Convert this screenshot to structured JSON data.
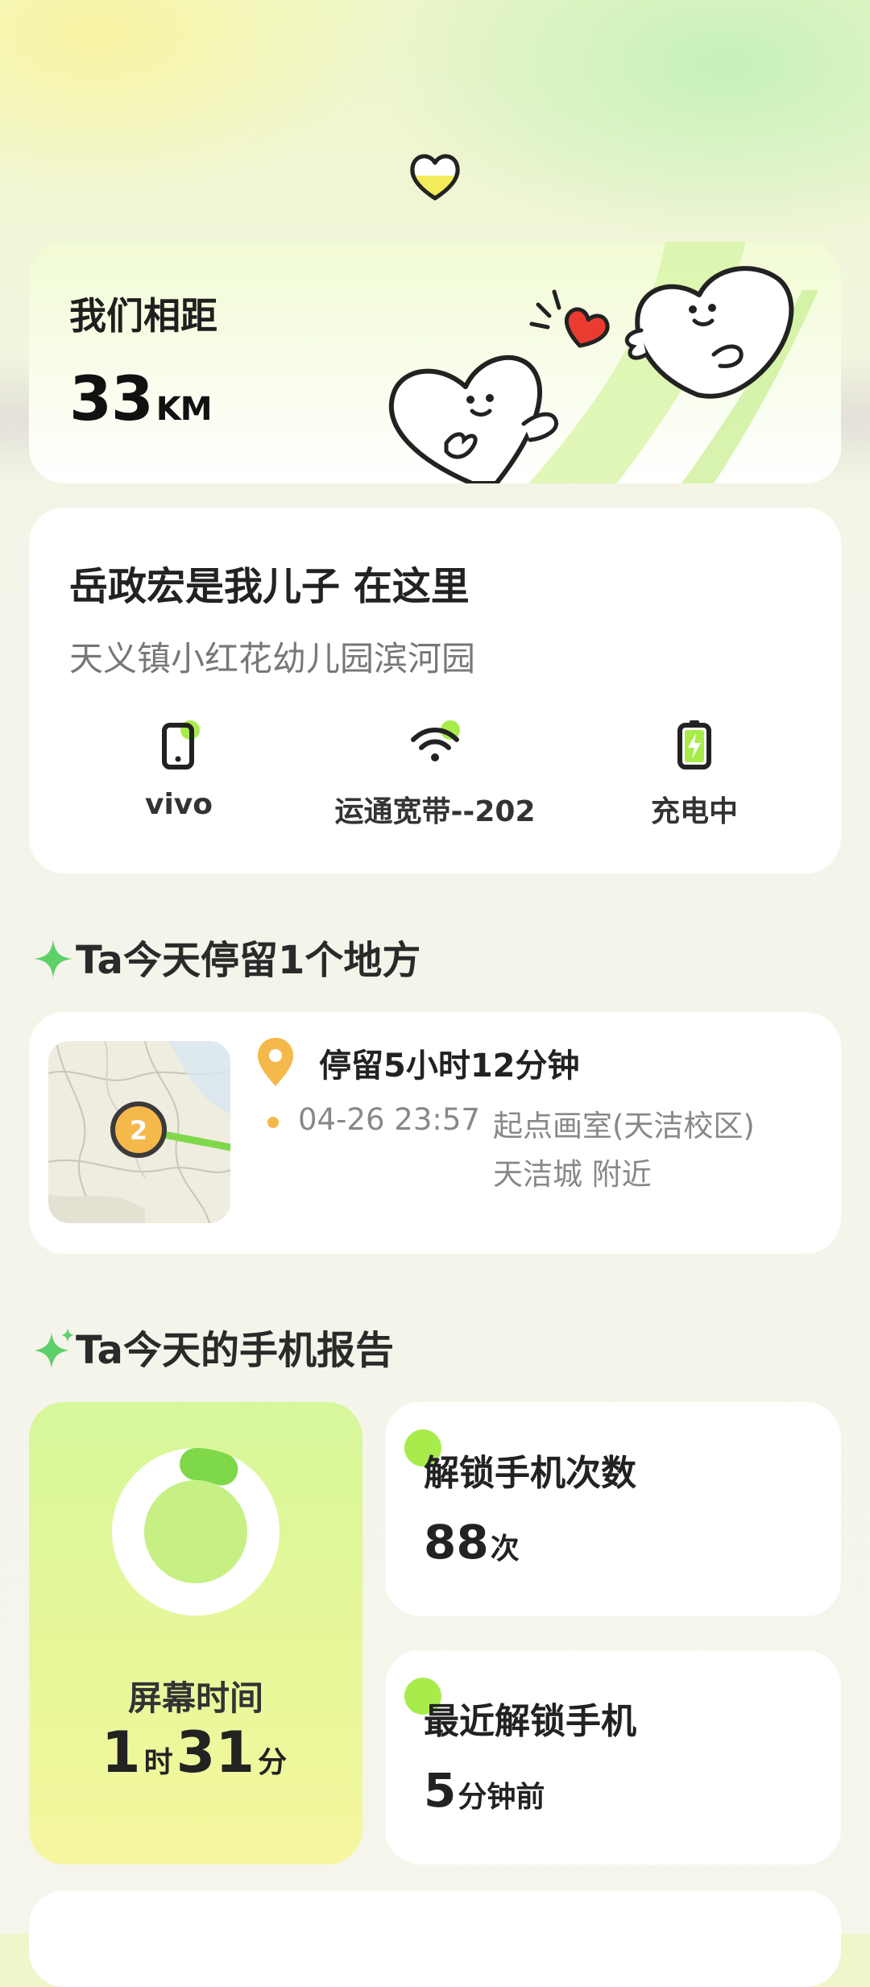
{
  "distance": {
    "label": "我们相距",
    "value": "33",
    "unit": "KM"
  },
  "location": {
    "title": "岳政宏是我儿子 在这里",
    "address": "天义镇小红花幼儿园滨河园",
    "status": [
      {
        "icon": "phone-icon",
        "label": "vivo"
      },
      {
        "icon": "wifi-icon",
        "label": "运通宽带--202"
      },
      {
        "icon": "battery-charging-icon",
        "label": "充电中"
      }
    ]
  },
  "stay_section": {
    "title": "Ta今天停留1个地方"
  },
  "stay": {
    "marker": "2",
    "duration": "停留5小时12分钟",
    "time": "04-26 23:57",
    "place": "起点画室(天洁校区)天洁城 附近"
  },
  "report_section": {
    "title": "Ta今天的手机报告"
  },
  "screen_time": {
    "label": "屏幕时间",
    "hours": "1",
    "hours_unit": "时",
    "minutes": "31",
    "minutes_unit": "分",
    "fraction": 0.063
  },
  "unlock_count": {
    "label": "解锁手机次数",
    "value": "88",
    "unit": "次"
  },
  "last_unlock": {
    "label": "最近解锁手机",
    "value": "5",
    "unit": "分钟前"
  },
  "colors": {
    "accent_green": "#a8ec4c",
    "orange": "#f5b84a"
  }
}
